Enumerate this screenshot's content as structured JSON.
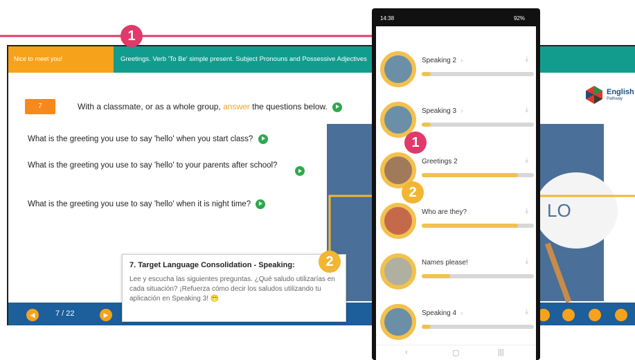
{
  "slide": {
    "tab_active": "Nice to meet you!",
    "tab_topic": "Greetings. Verb 'To Be' simple present. Subject Pronouns and Possessive Adjectives",
    "logo_text": "English",
    "logo_sub": "Pathway",
    "activity_number": "7",
    "instruction_before": "With a classmate, or as a whole group, ",
    "instruction_highlight": "answer",
    "instruction_after": " the questions below.",
    "questions": [
      "What is the greeting you use to say 'hello' when you start class?",
      "What is the greeting you use to say 'hello' to your parents after school?",
      "What is the greeting you use to say 'hello' when it is night time?"
    ],
    "photo_sign_text": "LO",
    "page_count": "7 / 22"
  },
  "card": {
    "title": "7. Target Language Consolidation - Speaking:",
    "body": "Lee y escucha las siguientes preguntas. ¿Qué saludo utilizarías en cada situación? ¡Refuerza cómo decir los saludos utilizando tu aplicación en Speaking 3! 😁"
  },
  "phone": {
    "time": "14:38",
    "status_right": "92%",
    "items": [
      {
        "title": "Speaking 2",
        "progress": 0.08,
        "has_chevron": true
      },
      {
        "title": "Speaking 3",
        "progress": 0.08,
        "has_chevron": true
      },
      {
        "title": "Greetings 2",
        "progress": 0.86,
        "has_chevron": false
      },
      {
        "title": "Who are they?",
        "progress": 0.86,
        "has_chevron": false
      },
      {
        "title": "Names please!",
        "progress": 0.25,
        "has_chevron": false
      },
      {
        "title": "Speaking 4",
        "progress": 0.08,
        "has_chevron": true
      }
    ],
    "nav_back": "‹",
    "nav_home": "▢",
    "nav_recent": "|||"
  },
  "markers": {
    "first": "1",
    "second": "2"
  },
  "colors": {
    "marker_1": "#e0396a",
    "marker_2": "#f2b632",
    "teal": "#129c8e",
    "orange": "#f7a21b",
    "blue_bar": "#1c5f9b"
  }
}
